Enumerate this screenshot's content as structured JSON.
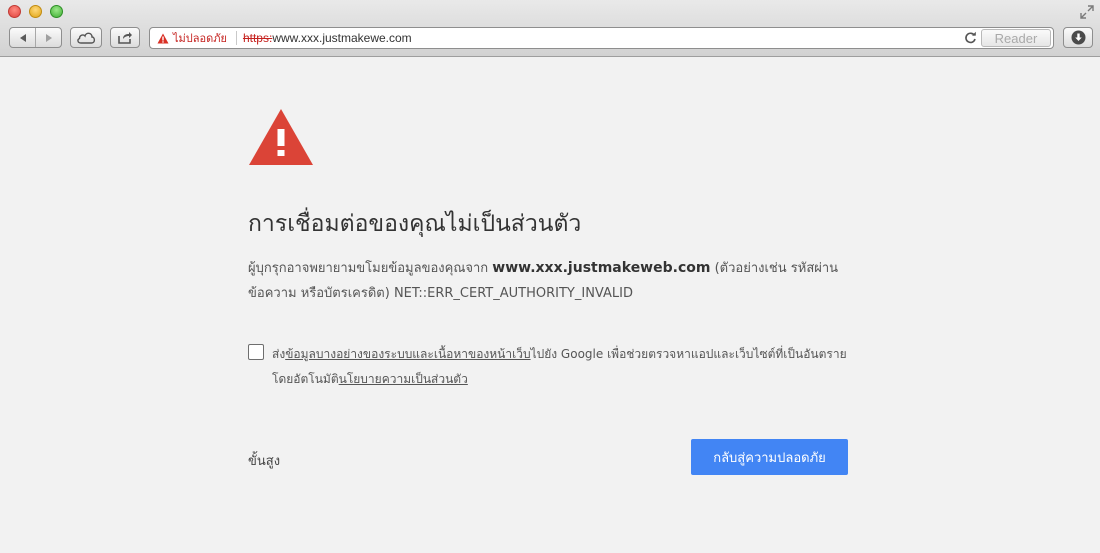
{
  "toolbar": {
    "security_label": "ไม่ปลอดภัย",
    "url_scheme": "https:",
    "url_host": " www.xxx.justmakewe.com",
    "reader_label": "Reader"
  },
  "page": {
    "heading": "การเชื่อมต่อของคุณไม่เป็นส่วนตัว",
    "desc_prefix": "ผู้บุกรุกอาจพยายามขโมยข้อมูลของคุณจาก ",
    "desc_domain": "www.xxx.justmakeweb.com",
    "desc_suffix": " (ตัวอย่างเช่น รหัสผ่าน ข้อความ หรือบัตรเครดิต) NET::ERR_CERT_AUTHORITY_INVALID",
    "optin_prefix": "ส่ง",
    "optin_link1": "ข้อมูลบางอย่างของระบบและเนื้อหาของหน้าเว็บ",
    "optin_middle": "ไปยัง Google เพื่อช่วยตรวจหาแอปและเว็บไซต์ที่เป็นอันตรายโดยอัตโนมัติ",
    "optin_link2": "นโยบายความเป็นส่วนตัว",
    "advanced_label": "ขั้นสูง",
    "back_button_label": "กลับสู่ความปลอดภัย"
  },
  "colors": {
    "warning_red": "#d93025",
    "button_blue": "#4285f4",
    "background": "#f2f2f2"
  },
  "icons": {
    "warning": "warning-triangle-icon",
    "back": "back-arrow-icon",
    "forward": "forward-arrow-icon",
    "icloud": "cloud-icon",
    "share": "share-icon",
    "reload": "reload-icon",
    "download": "download-icon",
    "fullscreen": "fullscreen-icon"
  }
}
